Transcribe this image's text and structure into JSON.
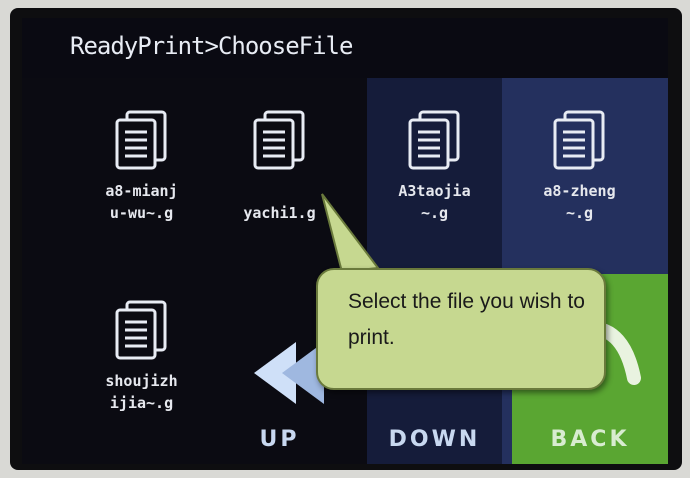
{
  "breadcrumb": "ReadyPrint>ChooseFile",
  "files": [
    {
      "label": "a8-mianj\nu-wu~.g",
      "icon": "document-icon"
    },
    {
      "label": "yachi1.g",
      "icon": "document-icon"
    },
    {
      "label": "A3taojia\n~.g",
      "icon": "document-icon"
    },
    {
      "label": "a8-zheng\n~.g",
      "icon": "document-icon"
    },
    {
      "label": "shoujizh\nijia~.g",
      "icon": "document-icon"
    }
  ],
  "buttons": {
    "up": "UP",
    "down": "DOWN",
    "back": "BACK"
  },
  "callout": {
    "text": "Select the file you wish to print."
  },
  "colors": {
    "back_button": "#5aa632",
    "callout_fill": "#c6d890",
    "up_arrow": "#cfe0f8"
  }
}
